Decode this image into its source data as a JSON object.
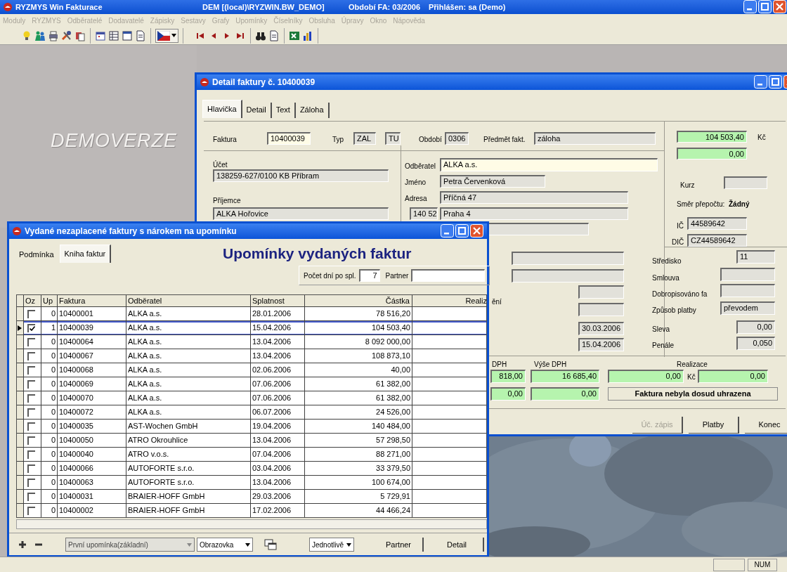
{
  "app_window": {
    "title_parts": [
      "RYZMYS Win  Fakturace",
      "DEM [(local)\\RYZWIN.BW_DEMO]",
      "Období FA: 03/2006",
      "Přihlášen: sa (Demo)"
    ]
  },
  "menu": [
    {
      "label": "Moduly",
      "disabled": true
    },
    {
      "label": "RYZMYS",
      "disabled": true
    },
    {
      "label": "Odběratelé",
      "disabled": true
    },
    {
      "label": "Dodavatelé",
      "disabled": true
    },
    {
      "label": "Zápisky",
      "disabled": true
    },
    {
      "label": "Sestavy",
      "disabled": true
    },
    {
      "label": "Grafy",
      "disabled": true
    },
    {
      "label": "Upomínky",
      "disabled": true
    },
    {
      "label": "Číselníky",
      "disabled": true
    },
    {
      "label": "Obsluha",
      "disabled": true
    },
    {
      "label": "Úpravy",
      "disabled": true
    },
    {
      "label": "Okno",
      "disabled": true
    },
    {
      "label": "Nápověda",
      "disabled": true
    }
  ],
  "background_text": "DEMOVERZE",
  "detail_window": {
    "title": "Detail faktury č. 10400039",
    "tabs": [
      {
        "label": "Hlavička",
        "selected": true
      },
      {
        "label": "Detail",
        "selected": false
      },
      {
        "label": "Text",
        "selected": false
      },
      {
        "label": "Záloha",
        "selected": false
      }
    ],
    "form": [
      {
        "kind": "label",
        "text": "Faktura"
      },
      {
        "kind": "input",
        "value": "10400039"
      },
      {
        "kind": "label",
        "text": "Typ"
      },
      {
        "kind": "readonly",
        "value": "ZAL"
      },
      {
        "kind": "readonly",
        "value": "TU"
      },
      {
        "kind": "label",
        "text": "Období"
      },
      {
        "kind": "readonly",
        "value": "0306"
      },
      {
        "kind": "label",
        "text": "Předmět fakt."
      },
      {
        "kind": "readonly",
        "value": "záloha"
      },
      {
        "kind": "amount",
        "value": "104 503,40"
      },
      {
        "kind": "label",
        "text": "Kč"
      },
      {
        "kind": "amount",
        "value": "0,00"
      },
      {
        "kind": "label",
        "text": "Účet"
      },
      {
        "kind": "readonly",
        "value": "138259-627/0100 KB Příbram"
      },
      {
        "kind": "label",
        "text": "Příjemce"
      },
      {
        "kind": "readonly",
        "value": "ALKA Hořovice"
      },
      {
        "kind": "label",
        "text": "Odběratel"
      },
      {
        "kind": "input",
        "value": "ALKA a.s."
      },
      {
        "kind": "label",
        "text": "Jméno"
      },
      {
        "kind": "readonly",
        "value": "Petra Červenková"
      },
      {
        "kind": "label",
        "text": "Adresa"
      },
      {
        "kind": "readonly",
        "value": "Příčná 47"
      },
      {
        "kind": "readonly",
        "value": "140 52"
      },
      {
        "kind": "readonly",
        "value": "Praha 4"
      },
      {
        "kind": "readonly"
      },
      {
        "kind": "label",
        "text": "Kurz"
      },
      {
        "kind": "readonly"
      },
      {
        "kind": "label",
        "text": "Směr přepočtu:"
      },
      {
        "kind": "strong",
        "text": "Žádný"
      },
      {
        "kind": "label",
        "text": "IČ"
      },
      {
        "kind": "readonly",
        "value": "44589642"
      },
      {
        "kind": "label",
        "text": "DIČ"
      },
      {
        "kind": "readonly",
        "value": "CZ44589642"
      },
      {
        "kind": "readonly"
      },
      {
        "kind": "readonly"
      },
      {
        "kind": "readonly"
      },
      {
        "kind": "label",
        "text": "ění"
      },
      {
        "kind": "readonly"
      },
      {
        "kind": "readonly",
        "value": "30.03.2006"
      },
      {
        "kind": "readonly",
        "value": "15.04.2006"
      },
      {
        "kind": "label",
        "text": "Středisko"
      },
      {
        "kind": "readonly",
        "value": "11"
      },
      {
        "kind": "label",
        "text": "Smlouva"
      },
      {
        "kind": "readonly"
      },
      {
        "kind": "label",
        "text": "Dobropisováno fa"
      },
      {
        "kind": "readonly"
      },
      {
        "kind": "label",
        "text": "Způsob platby"
      },
      {
        "kind": "readonly",
        "value": "převodem"
      },
      {
        "kind": "label",
        "text": "Sleva"
      },
      {
        "kind": "readonly",
        "value": "0,00"
      },
      {
        "kind": "label",
        "text": "Penále"
      },
      {
        "kind": "readonly",
        "value": "0,050"
      },
      {
        "kind": "label",
        "text": "DPH"
      },
      {
        "kind": "label",
        "text": "Výše DPH"
      },
      {
        "kind": "label",
        "text": "Realizace"
      },
      {
        "kind": "amount",
        "value": "818,00"
      },
      {
        "kind": "amount",
        "value": "16 685,40"
      },
      {
        "kind": "amount",
        "value": "0,00"
      },
      {
        "kind": "label",
        "text": "Kč"
      },
      {
        "kind": "amount",
        "value": "0,00"
      },
      {
        "kind": "amount",
        "value": "0,00"
      },
      {
        "kind": "amount",
        "value": "0,00"
      },
      {
        "kind": "status",
        "text": "Faktura nebyla dosud uhrazena"
      }
    ],
    "buttons": [
      {
        "label": "Úč. zápis",
        "disabled": true
      },
      {
        "label": "Platby",
        "disabled": false
      },
      {
        "label": "Konec",
        "disabled": false
      }
    ]
  },
  "list_window": {
    "title": "Vydané nezaplacené faktury s nárokem na upomínku",
    "tabs": [
      {
        "label": "Podmínka",
        "selected": false
      },
      {
        "label": "Kniha faktur",
        "selected": true
      }
    ],
    "heading": "Upomínky vydaných faktur",
    "filter": {
      "days_label": "Počet dní po spl.",
      "days_value": "7",
      "partner_label": "Partner"
    },
    "table": {
      "columns": [
        "Oz",
        "Up",
        "Faktura",
        "Odběratel",
        "Splatnost",
        "Částka",
        "Realiz"
      ],
      "rows": [
        {
          "oz_checked": false,
          "up": "0",
          "faktura": "10400001",
          "odberatel": "ALKA a.s.",
          "splatnost": "28.01.2006",
          "castka": "78 516,20",
          "selected": false
        },
        {
          "oz_checked": true,
          "up": "1",
          "faktura": "10400039",
          "odberatel": "ALKA a.s.",
          "splatnost": "15.04.2006",
          "castka": "104 503,40",
          "selected": true
        },
        {
          "oz_checked": false,
          "up": "0",
          "faktura": "10400064",
          "odberatel": "ALKA a.s.",
          "splatnost": "13.04.2006",
          "castka": "8 092 000,00",
          "selected": false
        },
        {
          "oz_checked": false,
          "up": "0",
          "faktura": "10400067",
          "odberatel": "ALKA a.s.",
          "splatnost": "13.04.2006",
          "castka": "108 873,10",
          "selected": false
        },
        {
          "oz_checked": false,
          "up": "0",
          "faktura": "10400068",
          "odberatel": "ALKA a.s.",
          "splatnost": "02.06.2006",
          "castka": "40,00",
          "selected": false
        },
        {
          "oz_checked": false,
          "up": "0",
          "faktura": "10400069",
          "odberatel": "ALKA a.s.",
          "splatnost": "07.06.2006",
          "castka": "61 382,00",
          "selected": false
        },
        {
          "oz_checked": false,
          "up": "0",
          "faktura": "10400070",
          "odberatel": "ALKA a.s.",
          "splatnost": "07.06.2006",
          "castka": "61 382,00",
          "selected": false
        },
        {
          "oz_checked": false,
          "up": "0",
          "faktura": "10400072",
          "odberatel": "ALKA a.s.",
          "splatnost": "06.07.2006",
          "castka": "24 526,00",
          "selected": false
        },
        {
          "oz_checked": false,
          "up": "0",
          "faktura": "10400035",
          "odberatel": "AST-Wochen GmbH",
          "splatnost": "19.04.2006",
          "castka": "140 484,00",
          "selected": false
        },
        {
          "oz_checked": false,
          "up": "0",
          "faktura": "10400050",
          "odberatel": "ATRO Okrouhlice",
          "splatnost": "13.04.2006",
          "castka": "57 298,50",
          "selected": false
        },
        {
          "oz_checked": false,
          "up": "0",
          "faktura": "10400040",
          "odberatel": "ATRO v.o.s.",
          "splatnost": "07.04.2006",
          "castka": "88 271,00",
          "selected": false
        },
        {
          "oz_checked": false,
          "up": "0",
          "faktura": "10400066",
          "odberatel": "AUTOFORTE s.r.o.",
          "splatnost": "03.04.2006",
          "castka": "33 379,50",
          "selected": false
        },
        {
          "oz_checked": false,
          "up": "0",
          "faktura": "10400063",
          "odberatel": "AUTOFORTE s.r.o.",
          "splatnost": "13.04.2006",
          "castka": "100 674,00",
          "selected": false
        },
        {
          "oz_checked": false,
          "up": "0",
          "faktura": "10400031",
          "odberatel": "BRAIER-HOFF GmbH",
          "splatnost": "29.03.2006",
          "castka": "5 729,91",
          "selected": false
        },
        {
          "oz_checked": false,
          "up": "0",
          "faktura": "10400002",
          "odberatel": "BRAIER-HOFF GmbH",
          "splatnost": "17.02.2006",
          "castka": "44 466,24",
          "selected": false
        }
      ]
    },
    "footer": [
      {
        "kind": "add"
      },
      {
        "kind": "remove"
      },
      {
        "kind": "dropdown",
        "label": "První upomínka(základní)",
        "disabled": true
      },
      {
        "kind": "dropdown",
        "label": "Obrazovka",
        "disabled": false
      },
      {
        "kind": "windows"
      },
      {
        "kind": "dropdown",
        "label": "Jednotlivě",
        "disabled": false
      },
      {
        "kind": "button",
        "label": "Partner"
      },
      {
        "kind": "button",
        "label": "Detail"
      }
    ]
  },
  "status_bar": {
    "indicators": [
      "NUM"
    ]
  }
}
